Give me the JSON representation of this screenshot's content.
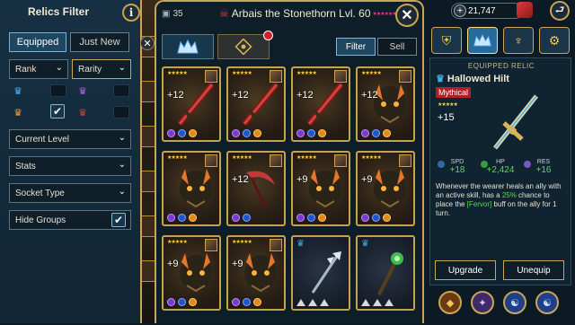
{
  "filter": {
    "title": "Relics Filter",
    "info_label": "i",
    "tabs": [
      {
        "label": "Equipped",
        "active": true
      },
      {
        "label": "Just New",
        "active": false
      }
    ],
    "rank_label": "Rank",
    "rarity_label": "Rarity",
    "dropdowns": [
      {
        "label": "Current Level"
      },
      {
        "label": "Stats"
      },
      {
        "label": "Socket Type"
      }
    ],
    "hide_groups_label": "Hide Groups",
    "hide_groups_checked": true,
    "check_glyph": "✔",
    "chevron_glyph": "⌄"
  },
  "inventory": {
    "count": "35",
    "champion_name": "Arbais the Stonethorn Lvl. 60",
    "champion_stars": "★★★★★★",
    "close_label": "✕",
    "filter_button": "Filter",
    "sell_button": "Sell",
    "badge_count": "",
    "cards": [
      {
        "level": "+12",
        "gems": [
          "p",
          "b",
          "o"
        ],
        "art": "sword-red",
        "frame": "gold"
      },
      {
        "level": "+12",
        "gems": [
          "p",
          "b",
          "o"
        ],
        "art": "sword-red",
        "frame": "gold"
      },
      {
        "level": "+12",
        "gems": [
          "p",
          "b",
          "o"
        ],
        "art": "sword-red",
        "frame": "gold"
      },
      {
        "level": "+12",
        "gems": [
          "p",
          "b",
          "o"
        ],
        "art": "demon-mask",
        "frame": "gold"
      },
      {
        "level": "",
        "gems": [
          "p",
          "b",
          "o"
        ],
        "art": "demon-mask",
        "frame": "gold"
      },
      {
        "level": "+12",
        "gems": [
          "p",
          "b"
        ],
        "art": "scythe",
        "frame": "gold"
      },
      {
        "level": "+9",
        "gems": [
          "p",
          "b",
          "o"
        ],
        "art": "demon-mask",
        "frame": "gold"
      },
      {
        "level": "+9",
        "gems": [
          "p",
          "b",
          "o"
        ],
        "art": "demon-mask",
        "frame": "gold"
      },
      {
        "level": "+9",
        "gems": [
          "p",
          "b",
          "o"
        ],
        "art": "demon-mask",
        "frame": "gold"
      },
      {
        "level": "+9",
        "gems": [
          "p",
          "b",
          "o"
        ],
        "art": "demon-mask",
        "frame": "gold"
      },
      {
        "level": "",
        "gems": [
          "t",
          "t",
          "t"
        ],
        "art": "trident",
        "frame": "blue"
      },
      {
        "level": "",
        "gems": [
          "t",
          "t",
          "t"
        ],
        "art": "staff-green",
        "frame": "blue"
      }
    ]
  },
  "currency": {
    "silver": "21,747",
    "plus_label": "+"
  },
  "detail": {
    "header": "EQUIPPED RELIC",
    "name": "Hallowed Hilt",
    "rarity": "Mythical",
    "rarity_color": "#b01e2a",
    "stars": "★★★★★",
    "level": "+15",
    "stats": [
      {
        "key": "SPD",
        "value": "+18"
      },
      {
        "key": "HP",
        "value": "+2,424"
      },
      {
        "key": "RES",
        "value": "+16"
      }
    ],
    "description_pre": "Whenever the wearer heals an ally with an active skill, has a ",
    "description_pct": "25%",
    "description_mid": " chance to place the ",
    "description_buff": "[Fervor]",
    "description_post": " buff on the ally for 1 turn.",
    "upgrade_label": "Upgrade",
    "unequip_label": "Unequip"
  },
  "colors": {
    "gold": "#caa457",
    "panel": "#163043",
    "positive": "#5fd35f",
    "mythical": "#b01e2a"
  }
}
